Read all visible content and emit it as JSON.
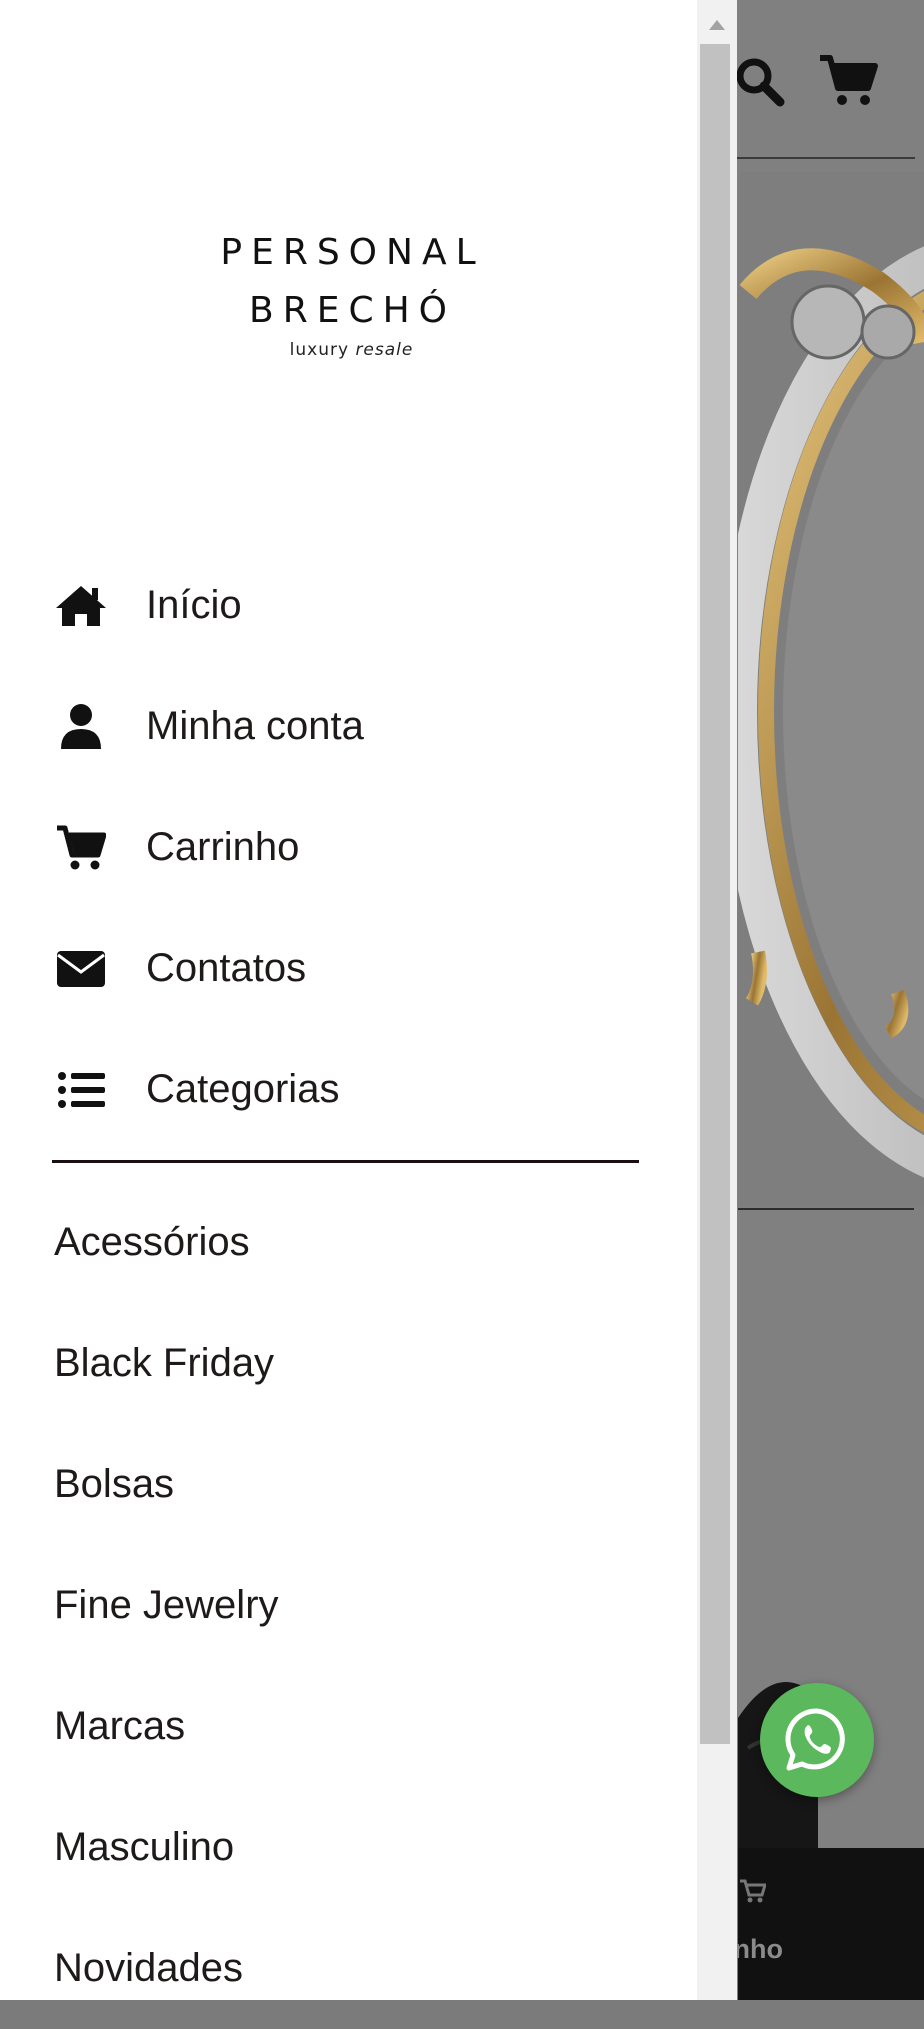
{
  "brand": {
    "line1": "PERSONAL",
    "line2": "BRECHÓ",
    "tagline_plain": "luxury ",
    "tagline_italic": "resale"
  },
  "nav": {
    "items": [
      {
        "label": "Início",
        "icon": "home-icon"
      },
      {
        "label": "Minha conta",
        "icon": "user-icon"
      },
      {
        "label": "Carrinho",
        "icon": "cart-icon"
      },
      {
        "label": "Contatos",
        "icon": "envelope-icon"
      },
      {
        "label": "Categorias",
        "icon": "list-icon"
      }
    ]
  },
  "categories": [
    "Acessórios",
    "Black Friday",
    "Bolsas",
    "Fine Jewelry",
    "Marcas",
    "Masculino",
    "Novidades"
  ],
  "background": {
    "bottom_bar_label": "inho"
  },
  "colors": {
    "drawer_bg": "#ffffff",
    "text": "#1f1a1a",
    "overlay": "#808080",
    "whatsapp": "#5cb85c"
  }
}
